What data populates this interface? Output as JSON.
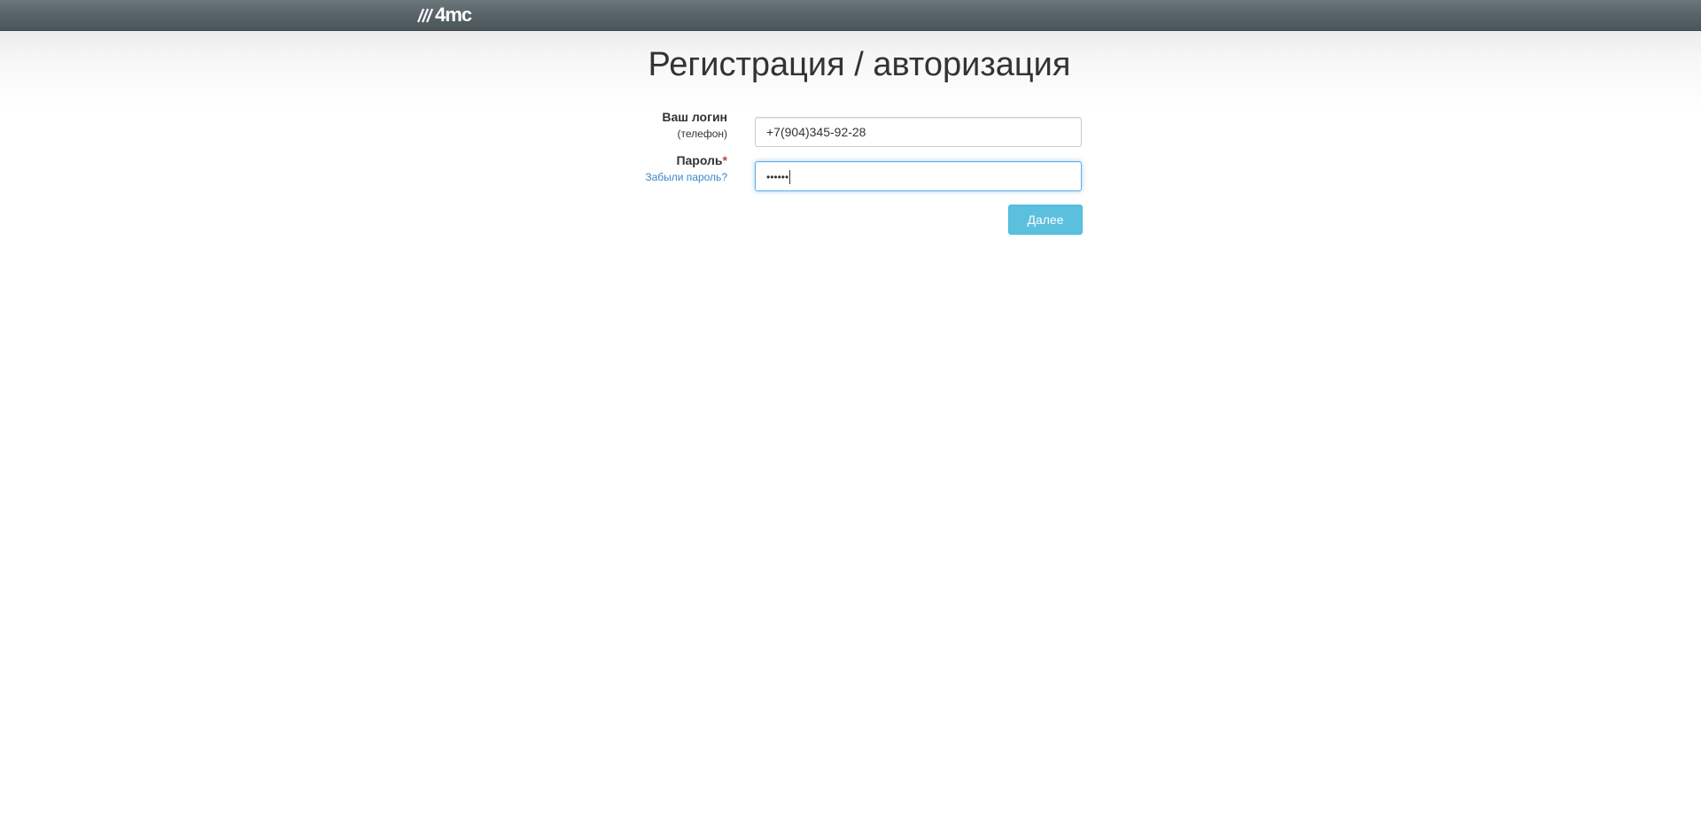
{
  "header": {
    "logo_text": "4mc"
  },
  "page": {
    "title": "Регистрация / авторизация"
  },
  "form": {
    "login_label": "Ваш логин",
    "login_sublabel": "(телефон)",
    "login_value": "+7(904)345-92-28",
    "password_label": "Пароль",
    "required_mark": "*",
    "forgot_password_link": "Забыли пароль?",
    "password_value_masked": "••••••",
    "submit_label": "Далее"
  },
  "colors": {
    "header_bg": "#59656a",
    "button_bg": "#5bc0de",
    "link": "#3a87c8",
    "focus_border": "#66afe9"
  },
  "icons": {
    "logo": "logo-slashes-icon"
  }
}
